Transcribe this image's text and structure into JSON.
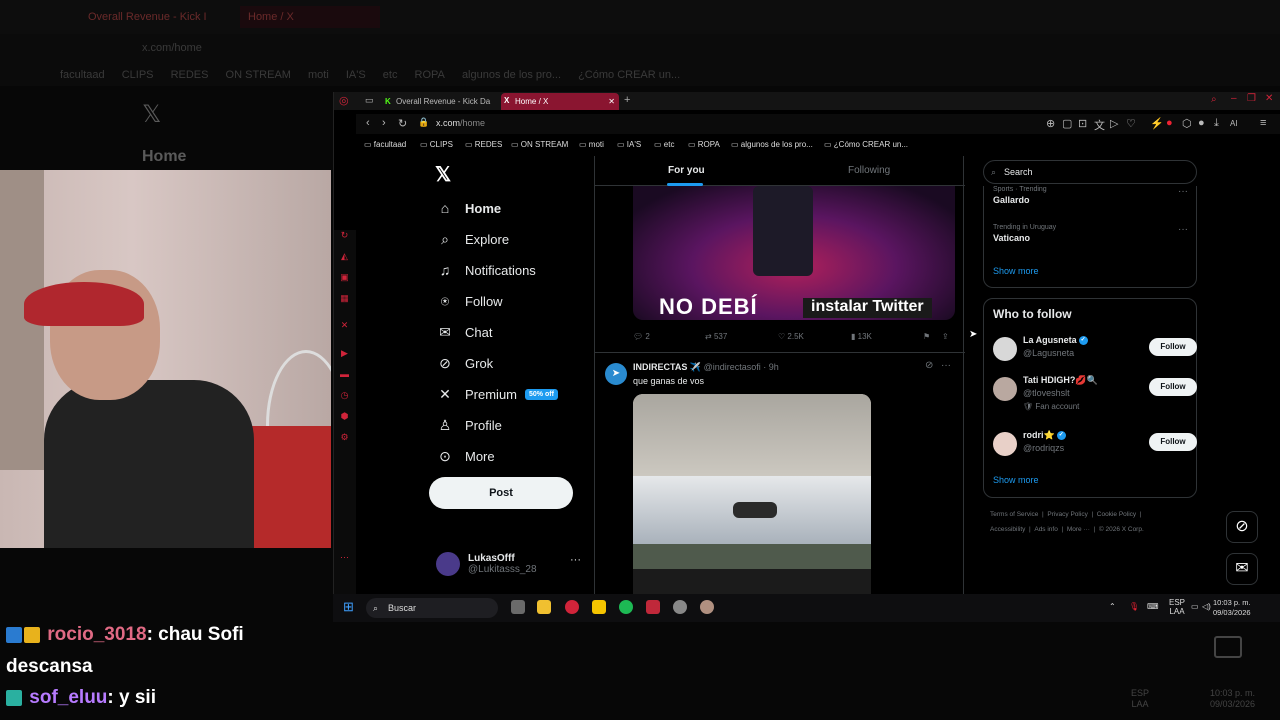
{
  "outer": {
    "tabs": [
      "Overall Revenue - Kick I",
      "Home / X"
    ],
    "address": "x.com/home",
    "bookmarks": [
      "facultaad",
      "CLIPS",
      "REDES",
      "ON STREAM",
      "moti",
      "IA'S",
      "etc",
      "ROPA",
      "algunos de los pro...",
      "¿Cómo CREAR un..."
    ],
    "x_home": "Home",
    "tray_lang": "ESP",
    "tray_region": "LAA",
    "time": "10:03 p. m.",
    "date": "09/03/2026"
  },
  "chat": [
    {
      "user": "rocio_3018",
      "message": ": chau Sofi descansa"
    },
    {
      "user": "sof_eluu",
      "message": ": y sii"
    }
  ],
  "browser": {
    "tabs": [
      {
        "label": "Overall Revenue - Kick Da",
        "icon": "K"
      },
      {
        "label": "Home / X",
        "icon": "X"
      }
    ],
    "url_host": "x.com",
    "url_path": "/home",
    "bookmarks": [
      "facultaad",
      "CLIPS",
      "REDES",
      "ON STREAM",
      "moti",
      "IA'S",
      "etc",
      "ROPA",
      "algunos de los pro...",
      "¿Cómo CREAR un..."
    ],
    "ai_label": "AI"
  },
  "x": {
    "nav": [
      {
        "label": "Home",
        "icon": "home-icon",
        "glyph": "⌂"
      },
      {
        "label": "Explore",
        "icon": "search-icon",
        "glyph": "⌕"
      },
      {
        "label": "Notifications",
        "icon": "bell-icon",
        "glyph": "🔔"
      },
      {
        "label": "Follow",
        "icon": "add-person-icon",
        "glyph": "👤"
      },
      {
        "label": "Chat",
        "icon": "mail-icon",
        "glyph": "✉"
      },
      {
        "label": "Grok",
        "icon": "grok-icon",
        "glyph": "⊘"
      },
      {
        "label": "Premium",
        "icon": "x-logo-icon",
        "glyph": "✕"
      },
      {
        "label": "Profile",
        "icon": "profile-icon",
        "glyph": "👤"
      },
      {
        "label": "More",
        "icon": "more-circle-icon",
        "glyph": "⊙"
      }
    ],
    "premium_badge": "50% off",
    "post_button": "Post",
    "account": {
      "name": "LukasOfff",
      "handle": "@Lukitasss_28"
    },
    "feed_tabs": {
      "for_you": "For you",
      "following": "Following"
    },
    "tweet1": {
      "media_text_left": "NO DEBÍ",
      "media_text_right": "instalar Twitter",
      "replies": "2",
      "reposts": "537",
      "likes": "2.5K",
      "views": "13K"
    },
    "tweet2": {
      "name": "INDIRECTAS ✈️",
      "handle": "@indirectasofi",
      "time": "· 9h",
      "text": "que ganas de vos"
    },
    "search_placeholder": "Search",
    "trends": [
      {
        "meta": "Sports · Trending",
        "name": "Gallardo"
      },
      {
        "meta": "Trending in Uruguay",
        "name": "Vaticano"
      }
    ],
    "show_more": "Show more",
    "who_to_follow_title": "Who to follow",
    "who_to_follow": [
      {
        "name": "La Agusneta",
        "handle": "@Lagusneta",
        "extra": "",
        "button": "Follow"
      },
      {
        "name": "Tati HDIGH?💋🔍",
        "handle": "@tloveshslt",
        "extra": "🛡 Fan account",
        "button": "Follow"
      },
      {
        "name": "rodri⭐",
        "handle": "@rodriqzs",
        "extra": "",
        "button": "Follow"
      }
    ],
    "footer_line1": [
      "Terms of Service",
      "|",
      "Privacy Policy",
      "|",
      "Cookie Policy",
      "|"
    ],
    "footer_line2": [
      "Accessibility",
      "|",
      "Ads info",
      "|",
      "More ···",
      "|",
      "© 2026 X Corp."
    ]
  },
  "taskbar": {
    "search_label": "Buscar",
    "lang": "ESP",
    "region": "LAA",
    "time": "10:03 p. m.",
    "date": "09/03/2026"
  },
  "colors": {
    "accent": "#1d9bf0",
    "active_tab": "#8a1530",
    "opera_red": "#d0243a"
  }
}
